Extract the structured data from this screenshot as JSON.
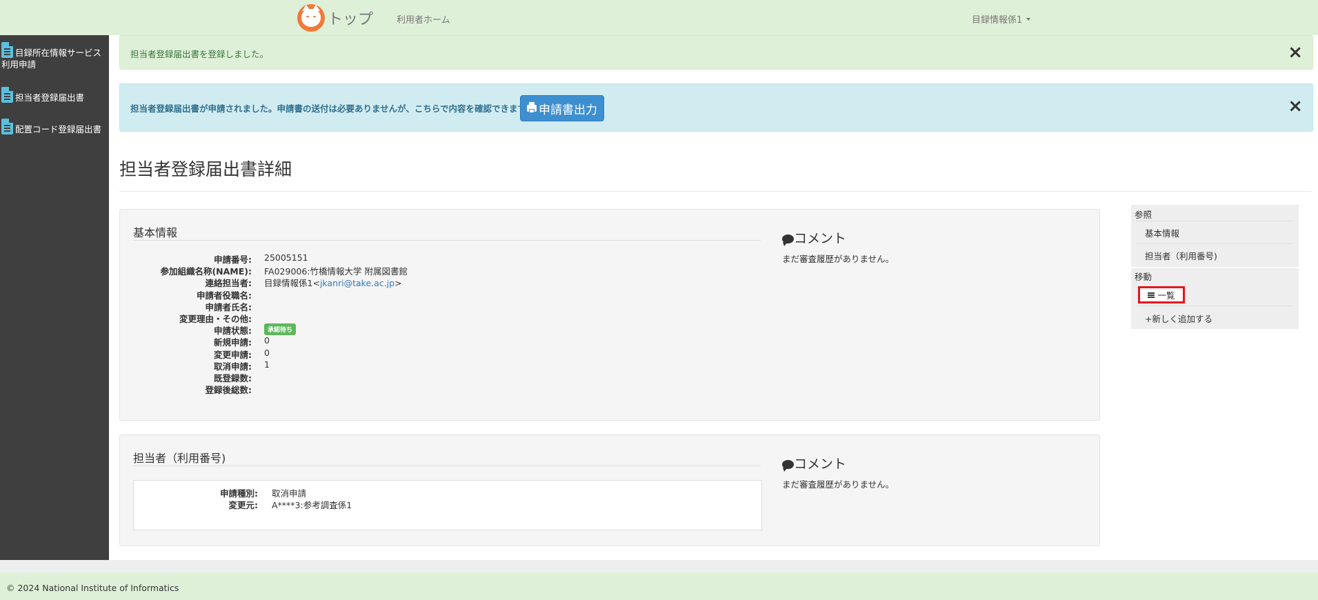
{
  "navbar": {
    "brand": "トップ",
    "home": "利用者ホーム",
    "user": "目録情報係1"
  },
  "sidebar": {
    "items": [
      {
        "label": "目録所在情報サービス利用申請"
      },
      {
        "label": "担当者登録届出書"
      },
      {
        "label": "配置コード登録届出書"
      }
    ]
  },
  "alerts": {
    "success": "担当者登録届出書を登録しました。",
    "info": "担当者登録届出書が申請されました。申請書の送付は必要ありませんが、こちらで内容を確認できます。",
    "print_button": "申請書出力",
    "close": "×"
  },
  "page": {
    "title": "担当者登録届出書詳細"
  },
  "basic": {
    "title": "基本情報",
    "fields": [
      {
        "label": "申請番号:",
        "value": "25005151"
      },
      {
        "label": "参加組織名称(NAME):",
        "value": "FA029006:竹橋情報大学 附属図書館"
      },
      {
        "label": "連絡担当者:",
        "value_prefix": "目録情報係1<",
        "email": "jkanri@take.ac.jp",
        "value_suffix": ">"
      },
      {
        "label": "申請者役職名:",
        "value": ""
      },
      {
        "label": "申請者氏名:",
        "value": ""
      },
      {
        "label": "変更理由・その他:",
        "value": ""
      },
      {
        "label": "申請状態:",
        "badge": "承認待ち"
      },
      {
        "label": "新規申請:",
        "value": "0"
      },
      {
        "label": "変更申請:",
        "value": "0"
      },
      {
        "label": "取消申請:",
        "value": "1"
      },
      {
        "label": "既登録数:",
        "value": ""
      },
      {
        "label": "登録後総数:",
        "value": ""
      }
    ],
    "comment_title": "コメント",
    "comment_empty": "まだ審査履歴がありません。"
  },
  "person": {
    "title": "担当者（利用番号)",
    "fields": [
      {
        "label": "申請種別:",
        "value": "取消申請"
      },
      {
        "label": "変更元:",
        "value": "A****3:参考調査係1"
      }
    ],
    "comment_title": "コメント",
    "comment_empty": "まだ審査履歴がありません。"
  },
  "right_nav": {
    "ref_heading": "参照",
    "ref_items": [
      "基本情報",
      "担当者（利用番号)"
    ],
    "move_heading": "移動",
    "list_button": "一覧",
    "add_new": "+新しく追加する"
  },
  "footer": {
    "copyright": "© 2024 National Institute of Informatics"
  },
  "colors": {
    "navbar_bg": "#dff0d8",
    "sidebar_bg": "#3f3f3f",
    "info_bg": "#d1ecf1",
    "print_button": "#3e8fd0",
    "badge": "#5cb85c",
    "highlight": "#e8141c"
  }
}
